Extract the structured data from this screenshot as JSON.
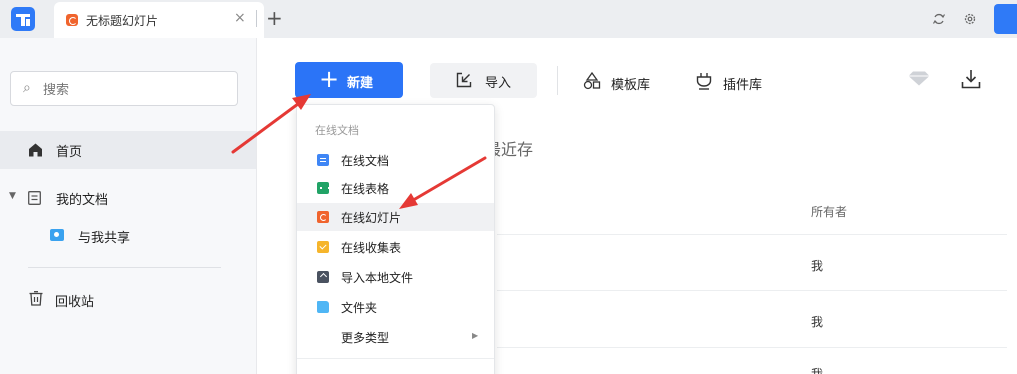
{
  "window": {
    "tab_title": "无标题幻灯片",
    "tab_close": "×",
    "new_tab": "+",
    "icons": [
      "app-logo-icon",
      "refresh-icon",
      "settings-icon"
    ]
  },
  "sidebar": {
    "search_placeholder": "搜索",
    "items": [
      {
        "label": "首页",
        "icon": "home-icon",
        "active": true
      },
      {
        "label": "我的文档",
        "icon": "document-icon"
      },
      {
        "label": "与我共享",
        "icon": "shared-folder-icon"
      },
      {
        "label": "回收站",
        "icon": "trash-icon"
      }
    ]
  },
  "toolbar": {
    "new_label": "新建",
    "import_label": "导入",
    "template_label": "模板库",
    "plugin_label": "插件库"
  },
  "main": {
    "section_title": "最近存",
    "columns": {
      "owner": "所有者"
    },
    "rows": [
      {
        "owner": "我"
      },
      {
        "owner": "我"
      },
      {
        "owner": "我"
      }
    ]
  },
  "menu": {
    "header": "在线文档",
    "items": [
      {
        "label": "在线文档",
        "icon": "online-doc-icon"
      },
      {
        "label": "在线表格",
        "icon": "online-sheet-icon"
      },
      {
        "label": "在线幻灯片",
        "icon": "online-slide-icon",
        "highlighted": true
      },
      {
        "label": "在线收集表",
        "icon": "online-form-icon"
      },
      {
        "label": "导入本地文件",
        "icon": "upload-icon"
      },
      {
        "label": "文件夹",
        "icon": "folder-icon"
      },
      {
        "label": "更多类型",
        "icon": "chevron-right-icon"
      }
    ]
  },
  "colors": {
    "accent": "#2b74f7",
    "annotation_arrow": "#e53935",
    "slide_icon": "#f0642d",
    "sheet_icon": "#21a366",
    "doc_icon": "#3f86f5",
    "form_icon": "#f6b52b"
  }
}
